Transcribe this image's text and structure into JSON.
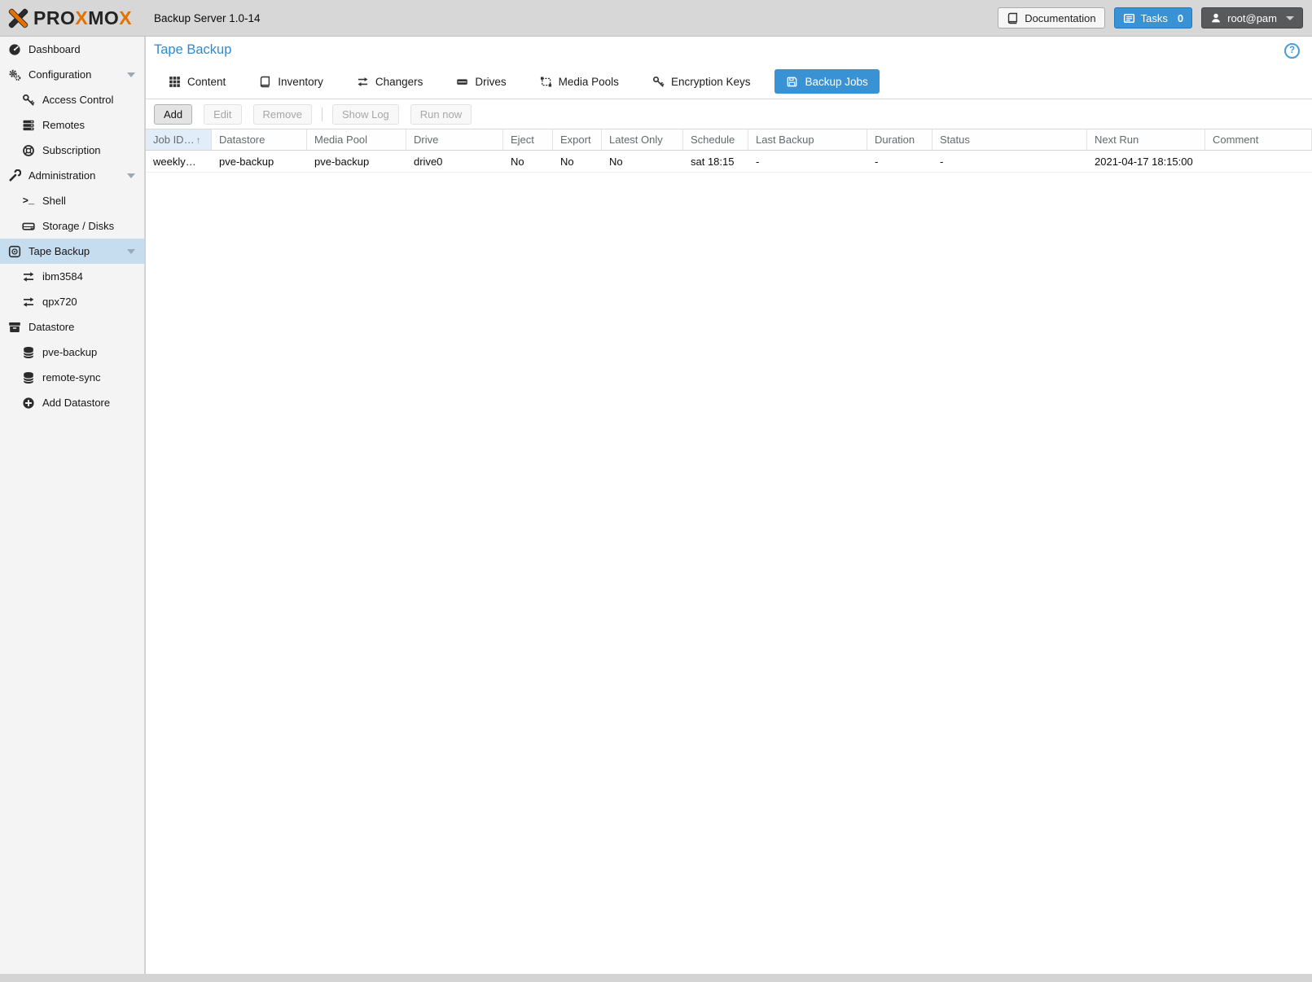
{
  "topbar": {
    "logo_parts": [
      "PRO",
      "X",
      "MO",
      "X"
    ],
    "title": "Backup Server 1.0-14",
    "documentation_label": "Documentation",
    "tasks_label": "Tasks",
    "tasks_count": "0",
    "user_label": "root@pam"
  },
  "sidebar": {
    "items": [
      {
        "label": "Dashboard"
      },
      {
        "label": "Configuration"
      },
      {
        "label": "Access Control"
      },
      {
        "label": "Remotes"
      },
      {
        "label": "Subscription"
      },
      {
        "label": "Administration"
      },
      {
        "label": "Shell"
      },
      {
        "label": "Storage / Disks"
      },
      {
        "label": "Tape Backup",
        "selected": true
      },
      {
        "label": "ibm3584"
      },
      {
        "label": "qpx720"
      },
      {
        "label": "Datastore"
      },
      {
        "label": "pve-backup"
      },
      {
        "label": "remote-sync"
      },
      {
        "label": "Add Datastore"
      }
    ]
  },
  "main": {
    "title": "Tape Backup",
    "tabs": [
      {
        "label": "Content"
      },
      {
        "label": "Inventory"
      },
      {
        "label": "Changers"
      },
      {
        "label": "Drives"
      },
      {
        "label": "Media Pools"
      },
      {
        "label": "Encryption Keys"
      },
      {
        "label": "Backup Jobs",
        "active": true
      }
    ],
    "toolbar": {
      "add": "Add",
      "edit": "Edit",
      "remove": "Remove",
      "show_log": "Show Log",
      "run_now": "Run now"
    },
    "table": {
      "columns": [
        "Job ID…",
        "Datastore",
        "Media Pool",
        "Drive",
        "Eject",
        "Export",
        "Latest Only",
        "Schedule",
        "Last Backup",
        "Duration",
        "Status",
        "Next Run",
        "Comment"
      ],
      "sorted_column": "Job ID",
      "rows": [
        [
          "weekly…",
          "pve-backup",
          "pve-backup",
          "drive0",
          "No",
          "No",
          "No",
          "sat 18:15",
          "-",
          "-",
          "-",
          "2021-04-17 18:15:00",
          ""
        ]
      ]
    }
  },
  "icons": {
    "sort_ascending": "↑",
    "help": "?",
    "shell_prompt": ">_"
  },
  "colors": {
    "accent_blue": "#3892d4",
    "brand_orange": "#e57000",
    "sidebar_selection": "#c6dcef",
    "topbar_gray": "#d7d7d7",
    "user_button_gray": "#58595b"
  }
}
